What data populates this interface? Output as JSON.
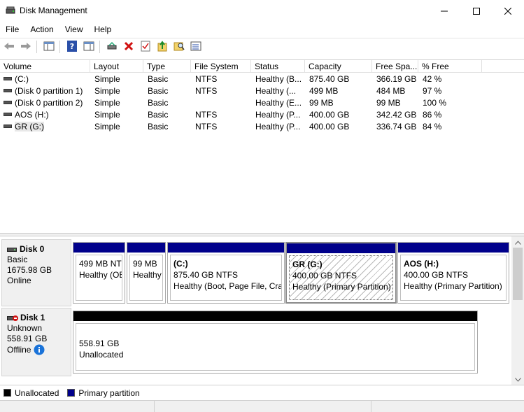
{
  "window": {
    "title": "Disk Management",
    "app_icon": "disk-management-icon",
    "controls": [
      "minimize-icon",
      "maximize-icon",
      "close-icon"
    ]
  },
  "menu": [
    "File",
    "Action",
    "View",
    "Help"
  ],
  "toolbar": {
    "buttons": [
      "back-arrow-icon",
      "forward-arrow-icon",
      "show-hide-console-tree-icon",
      "help-icon",
      "properties-pane-icon",
      "connect-drive-icon",
      "delete-icon",
      "check-icon",
      "export-up-icon",
      "search-folder-icon",
      "list-view-icon"
    ]
  },
  "volume_list": {
    "columns": [
      "Volume",
      "Layout",
      "Type",
      "File System",
      "Status",
      "Capacity",
      "Free Spa...",
      "% Free"
    ],
    "rows": [
      {
        "volume": "(C:)",
        "layout": "Simple",
        "type": "Basic",
        "fs": "NTFS",
        "status": "Healthy (B...",
        "capacity": "875.40 GB",
        "free": "366.19 GB",
        "pct": "42 %"
      },
      {
        "volume": "(Disk 0 partition 1)",
        "layout": "Simple",
        "type": "Basic",
        "fs": "NTFS",
        "status": "Healthy (...",
        "capacity": "499 MB",
        "free": "484 MB",
        "pct": "97 %"
      },
      {
        "volume": "(Disk 0 partition 2)",
        "layout": "Simple",
        "type": "Basic",
        "fs": "",
        "status": "Healthy (E...",
        "capacity": "99 MB",
        "free": "99 MB",
        "pct": "100 %"
      },
      {
        "volume": "AOS (H:)",
        "layout": "Simple",
        "type": "Basic",
        "fs": "NTFS",
        "status": "Healthy (P...",
        "capacity": "400.00 GB",
        "free": "342.42 GB",
        "pct": "86 %"
      },
      {
        "volume": "GR (G:)",
        "layout": "Simple",
        "type": "Basic",
        "fs": "NTFS",
        "status": "Healthy (P...",
        "capacity": "400.00 GB",
        "free": "336.74 GB",
        "pct": "84 %"
      }
    ]
  },
  "disks": [
    {
      "name": "Disk 0",
      "type": "Basic",
      "size": "1675.98 GB",
      "state": "Online",
      "icon": "disk-icon",
      "partitions": [
        {
          "name": "",
          "size": "499 MB NTF",
          "status": "Healthy (OE"
        },
        {
          "name": "",
          "size": "99 MB",
          "status": "Healthy"
        },
        {
          "name": "(C:)",
          "size": "875.40 GB NTFS",
          "status": "Healthy (Boot, Page File, Cras"
        },
        {
          "name": "GR  (G:)",
          "size": "400.00 GB NTFS",
          "status": "Healthy (Primary Partition)"
        },
        {
          "name": "AOS  (H:)",
          "size": "400.00 GB NTFS",
          "status": "Healthy (Primary Partition)"
        }
      ]
    },
    {
      "name": "Disk 1",
      "type": "Unknown",
      "size": "558.91 GB",
      "state": "Offline",
      "icon": "disk-offline-icon",
      "partitions": [
        {
          "size": "558.91 GB",
          "status": "Unallocated"
        }
      ]
    }
  ],
  "legend": [
    {
      "label": "Unallocated",
      "color": "#000000"
    },
    {
      "label": "Primary partition",
      "color": "#00008b"
    }
  ],
  "colors": {
    "primary_partition": "#00008b",
    "unallocated": "#000000",
    "info_icon": "#1a73d9"
  }
}
